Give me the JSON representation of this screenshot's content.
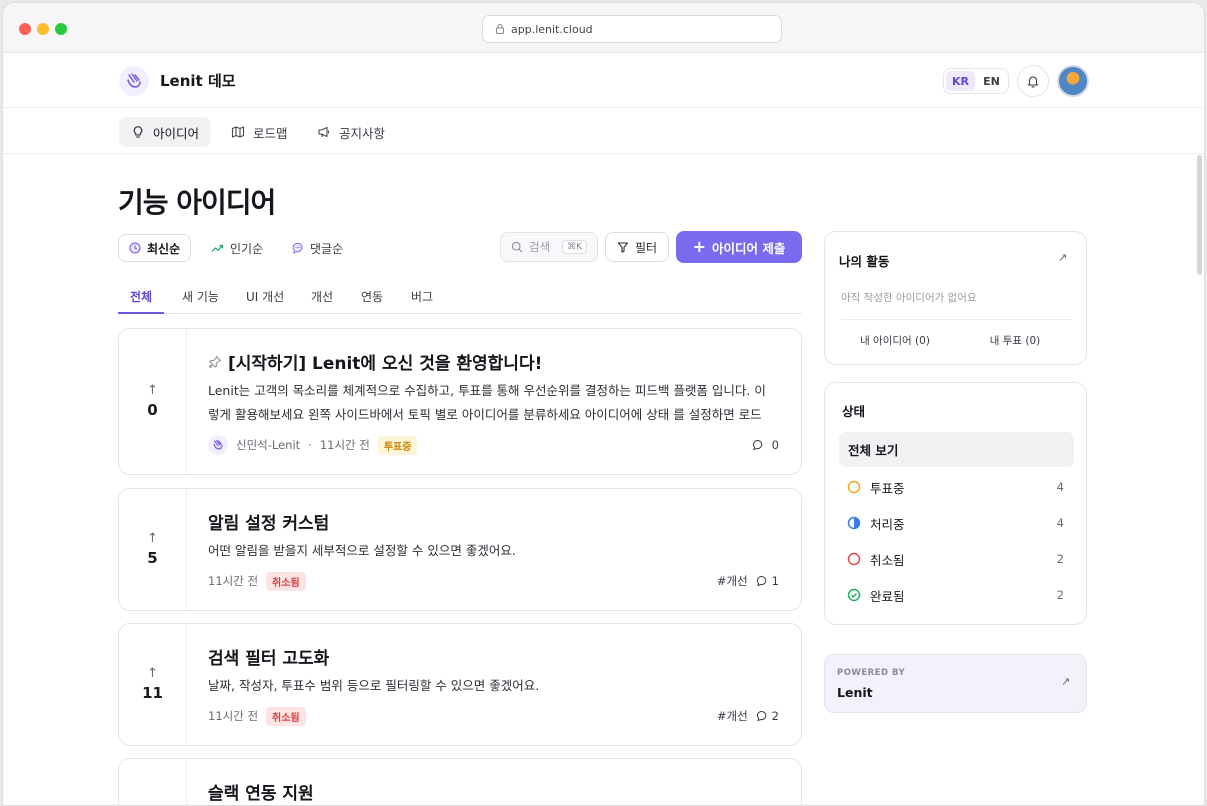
{
  "browser": {
    "url": "app.lenit.cloud"
  },
  "header": {
    "brand": "Lenit 데모",
    "lang_kr": "KR",
    "lang_en": "EN"
  },
  "nav": [
    {
      "label": "아이디어",
      "icon": "lightbulb-icon"
    },
    {
      "label": "로드맵",
      "icon": "map-icon"
    },
    {
      "label": "공지사항",
      "icon": "megaphone-icon"
    }
  ],
  "page": {
    "title": "기능 아이디어"
  },
  "sort": {
    "latest": "최신순",
    "popular": "인기순",
    "comments": "댓글순"
  },
  "toolbar": {
    "search_placeholder": "검색",
    "search_kbd": "⌘K",
    "filter": "필터",
    "submit": "아이디어 제출"
  },
  "tabs": [
    "전체",
    "새 기능",
    "UI 개선",
    "개선",
    "연동",
    "버그"
  ],
  "ideas": [
    {
      "votes": "0",
      "title": "[시작하기] Lenit에 오신 것을 환영합니다!",
      "pinned": true,
      "description": "Lenit는 고객의 목소리를 체계적으로 수집하고, 투표를 통해 우선순위를 결정하는 피드백 플랫폼 입니다. 이렇게 활용해보세요 왼쪽 사이드바에서 토픽 별로 아이디어를 분류하세요 아이디어에 상태 를 설정하면 로드맵...",
      "author": "신민석-Lenit",
      "time": "11시간 전",
      "status": "투표중",
      "tag": "",
      "comments": "0"
    },
    {
      "votes": "5",
      "title": "알림 설정 커스텀",
      "description": "어떤 알림을 받을지 세부적으로 설정할 수 있으면 좋겠어요.",
      "time": "11시간 전",
      "status": "취소됨",
      "tag": "#개선",
      "comments": "1"
    },
    {
      "votes": "11",
      "title": "검색 필터 고도화",
      "description": "날짜, 작성자, 투표수 범위 등으로 필터링할 수 있으면 좋겠어요.",
      "time": "11시간 전",
      "status": "취소됨",
      "tag": "#개선",
      "comments": "2"
    },
    {
      "title": "슬랙 연동 지원"
    }
  ],
  "activity": {
    "title": "나의 활동",
    "empty": "아직 작성한 아이디어가 없어요",
    "my_ideas": "내 아이디어 (0)",
    "my_votes": "내 투표 (0)"
  },
  "status_panel": {
    "title": "상태",
    "all": "전체 보기",
    "items": [
      {
        "label": "투표중",
        "count": "4",
        "color": "#f0a81e"
      },
      {
        "label": "처리중",
        "count": "4",
        "color": "#3b7de8"
      },
      {
        "label": "취소됨",
        "count": "2",
        "color": "#e04848"
      },
      {
        "label": "완료됨",
        "count": "2",
        "color": "#22b060"
      }
    ]
  },
  "powered": {
    "by": "POWERED BY",
    "name": "Lenit"
  }
}
